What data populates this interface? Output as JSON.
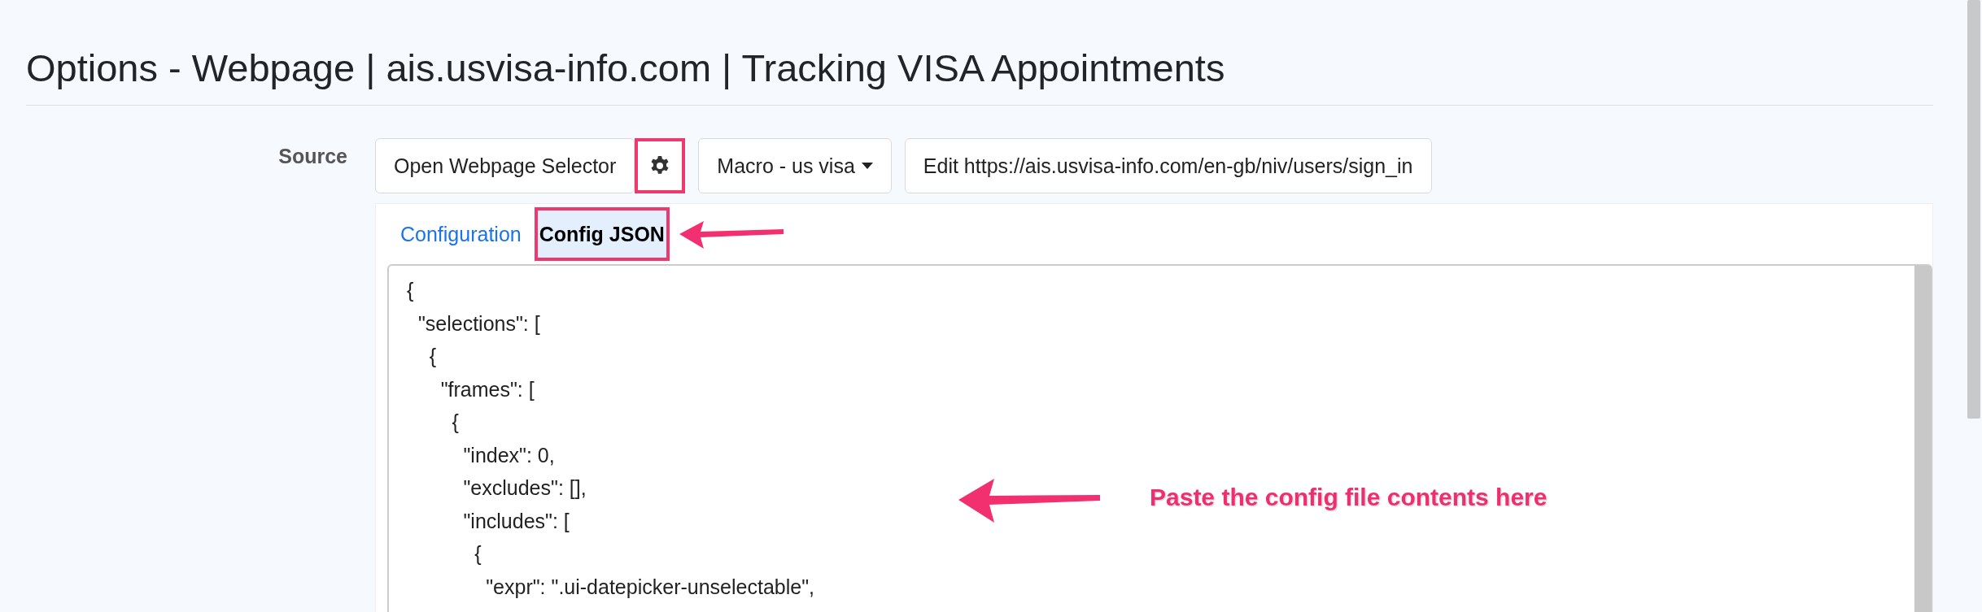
{
  "page": {
    "title": "Options - Webpage | ais.usvisa-info.com | Tracking VISA Appointments"
  },
  "source": {
    "label": "Source",
    "buttons": [
      {
        "kind": "text",
        "label": "Open Webpage Selector",
        "highlighted": false
      },
      {
        "kind": "gear",
        "highlighted": true
      },
      {
        "kind": "dropdown",
        "label": "Macro - us visa",
        "highlighted": false
      },
      {
        "kind": "text",
        "label": "Edit https://ais.usvisa-info.com/en-gb/niv/users/sign_in",
        "highlighted": false
      }
    ]
  },
  "tabs": [
    {
      "label": "Configuration",
      "selected": false,
      "highlighted": false
    },
    {
      "label": "Config JSON",
      "selected": true,
      "highlighted": true
    }
  ],
  "editor": {
    "lines": [
      "{",
      "  \"selections\": [",
      "    {",
      "      \"frames\": [",
      "        {",
      "          \"index\": 0,",
      "          \"excludes\": [],",
      "          \"includes\": [",
      "            {",
      "              \"expr\": \".ui-datepicker-unselectable\","
    ]
  },
  "annotation": {
    "note": "Paste the config file contents here"
  }
}
